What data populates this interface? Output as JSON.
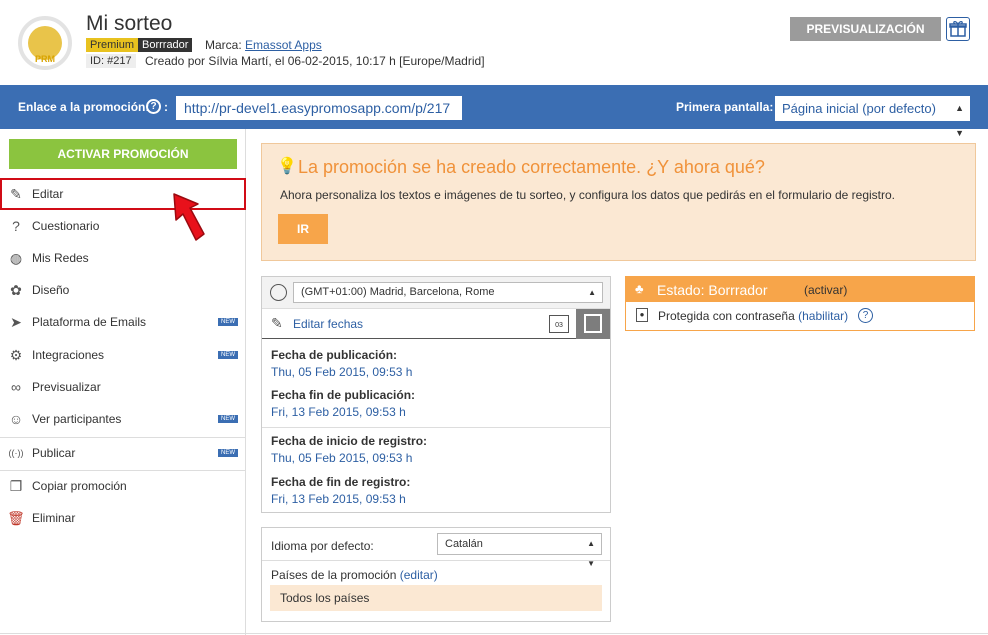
{
  "header": {
    "title": "Mi sorteo",
    "badge_premium": "Premium",
    "badge_status": "Borrrador",
    "marca_label": "Marca:",
    "marca_value": "Emassot Apps",
    "id_label": "ID: #217",
    "created": "Creado por Sílvia Martí, el 06-02-2015, 10:17 h [Europe/Madrid]",
    "preview_button": "PREVISUALIZACIÓN",
    "logo_text": "PRM"
  },
  "linkbar": {
    "label": "Enlace a la promoción:",
    "help": "?",
    "colon": ":",
    "url": "http://pr-devel1.easypromosapp.com/p/217",
    "first_screen_label": "Primera pantalla:",
    "first_screen_value": "Página inicial (por defecto)"
  },
  "sidebar": {
    "activate_button": "ACTIVAR PROMOCIÓN",
    "new_badge": "NEW",
    "items": [
      {
        "label": "Editar",
        "icon": "✎"
      },
      {
        "label": "Cuestionario",
        "icon": "?"
      },
      {
        "label": "Mis Redes",
        "icon": "◍"
      },
      {
        "label": "Diseño",
        "icon": "✿"
      },
      {
        "label": "Plataforma de Emails",
        "icon": "➤"
      },
      {
        "label": "Integraciones",
        "icon": "⚙"
      },
      {
        "label": "Previsualizar",
        "icon": "∞"
      },
      {
        "label": "Ver participantes",
        "icon": "☺"
      },
      {
        "label": "Publicar",
        "icon": "((·))"
      },
      {
        "label": "Copiar promoción",
        "icon": "❐"
      },
      {
        "label": "Eliminar",
        "icon": "🗑"
      }
    ]
  },
  "success": {
    "title": "La promoción se ha creado correctamente. ¿Y ahora qué?",
    "description": "Ahora personaliza los textos e imágenes de tu sorteo, y configura los datos que pedirás en el formulario de registro.",
    "button": "IR"
  },
  "dates": {
    "timezone": "(GMT+01:00) Madrid, Barcelona, Rome",
    "edit_label": "Editar fechas",
    "cal_day": "03",
    "pub_label": "Fecha de publicación:",
    "pub_value": "Thu, 05 Feb 2015, 09:53 h",
    "pub_end_label": "Fecha fin de publicación:",
    "pub_end_value": "Fri, 13 Feb 2015, 09:53 h",
    "reg_label": "Fecha de inicio de registro:",
    "reg_value": "Thu, 05 Feb 2015, 09:53 h",
    "reg_end_label": "Fecha de fin de registro:",
    "reg_end_value": "Fri, 13 Feb 2015, 09:53 h"
  },
  "language": {
    "label": "Idioma por defecto:",
    "value": "Catalán",
    "countries_label": "Países de la promoción",
    "countries_edit": "(editar)",
    "countries_value": "Todos los países"
  },
  "status": {
    "title": "Estado: Borrrador",
    "activate": "(activar)",
    "protected": "Protegida con contraseña",
    "enable": "(habilitar)",
    "help": "?"
  },
  "colors": {
    "blue": "#3b6eb3",
    "green": "#8bc43f",
    "orange": "#f7a54a",
    "red": "#d10c16"
  }
}
